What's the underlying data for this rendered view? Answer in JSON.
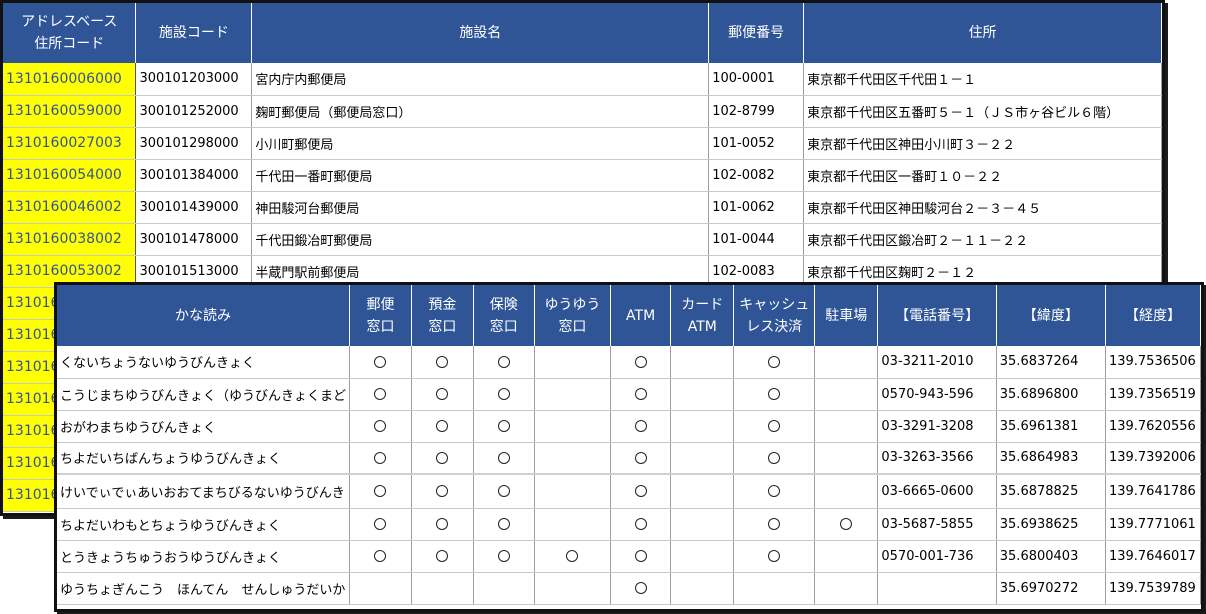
{
  "table1": {
    "headers": {
      "address_code": [
        "アドレスベース",
        "住所コード"
      ],
      "facility_code": "施設コード",
      "facility_name": "施設名",
      "postal_code": "郵便番号",
      "address": "住所"
    },
    "rows": [
      {
        "address_code": "1310160006000",
        "facility_code": "300101203000",
        "facility_name": "宮内庁内郵便局",
        "postal_code": "100-0001",
        "address": "東京都千代田区千代田１－１"
      },
      {
        "address_code": "1310160059000",
        "facility_code": "300101252000",
        "facility_name": "麹町郵便局（郵便局窓口）",
        "postal_code": "102-8799",
        "address": "東京都千代田区五番町５－１（ＪＳ市ヶ谷ビル６階）"
      },
      {
        "address_code": "1310160027003",
        "facility_code": "300101298000",
        "facility_name": "小川町郵便局",
        "postal_code": "101-0052",
        "address": "東京都千代田区神田小川町３－２２"
      },
      {
        "address_code": "1310160054000",
        "facility_code": "300101384000",
        "facility_name": "千代田一番町郵便局",
        "postal_code": "102-0082",
        "address": "東京都千代田区一番町１０－２２"
      },
      {
        "address_code": "1310160046002",
        "facility_code": "300101439000",
        "facility_name": "神田駿河台郵便局",
        "postal_code": "101-0062",
        "address": "東京都千代田区神田駿河台２－３－４５"
      },
      {
        "address_code": "1310160038002",
        "facility_code": "300101478000",
        "facility_name": "千代田鍛冶町郵便局",
        "postal_code": "101-0044",
        "address": "東京都千代田区鍛冶町２－１１－２２"
      },
      {
        "address_code": "1310160053002",
        "facility_code": "300101513000",
        "facility_name": "半蔵門駅前郵便局",
        "postal_code": "102-0083",
        "address": "東京都千代田区麹町２－１２"
      },
      {
        "address_code": "131016",
        "facility_code": "",
        "facility_name": "",
        "postal_code": "",
        "address": ""
      },
      {
        "address_code": "131016",
        "facility_code": "",
        "facility_name": "",
        "postal_code": "",
        "address": ""
      },
      {
        "address_code": "131016",
        "facility_code": "",
        "facility_name": "",
        "postal_code": "",
        "address": ""
      },
      {
        "address_code": "131016",
        "facility_code": "",
        "facility_name": "",
        "postal_code": "",
        "address": ""
      },
      {
        "address_code": "131016",
        "facility_code": "",
        "facility_name": "",
        "postal_code": "",
        "address": ""
      },
      {
        "address_code": "131016",
        "facility_code": "",
        "facility_name": "",
        "postal_code": "",
        "address": ""
      },
      {
        "address_code": "131016",
        "facility_code": "",
        "facility_name": "",
        "postal_code": "",
        "address": ""
      }
    ]
  },
  "table2": {
    "headers": {
      "kana": "かな読み",
      "postal_window": [
        "郵便",
        "窓口"
      ],
      "savings_window": [
        "預金",
        "窓口"
      ],
      "insurance_window": [
        "保険",
        "窓口"
      ],
      "yuyu_window": [
        "ゆうゆう",
        "窓口"
      ],
      "atm": "ATM",
      "card_atm": [
        "カード",
        "ATM"
      ],
      "cashless": [
        "キャッシュ",
        "レス決済"
      ],
      "parking": "駐車場",
      "phone": "【電話番号】",
      "latitude": "【緯度】",
      "longitude": "【経度】"
    },
    "mark_symbol": "circle",
    "rows": [
      {
        "kana": "くないちょうないゆうびんきょく",
        "postal_window": true,
        "savings_window": true,
        "insurance_window": true,
        "yuyu_window": false,
        "atm": true,
        "card_atm": false,
        "cashless": true,
        "parking": false,
        "phone": "03-3211-2010",
        "latitude": "35.6837264",
        "longitude": "139.7536506"
      },
      {
        "kana": "こうじまちゆうびんきょく（ゆうびんきょくまど",
        "postal_window": true,
        "savings_window": true,
        "insurance_window": true,
        "yuyu_window": false,
        "atm": true,
        "card_atm": false,
        "cashless": true,
        "parking": false,
        "phone": "0570-943-596",
        "latitude": "35.6896800",
        "longitude": "139.7356519"
      },
      {
        "kana": "おがわまちゆうびんきょく",
        "postal_window": true,
        "savings_window": true,
        "insurance_window": true,
        "yuyu_window": false,
        "atm": true,
        "card_atm": false,
        "cashless": true,
        "parking": false,
        "phone": "03-3291-3208",
        "latitude": "35.6961381",
        "longitude": "139.7620556"
      },
      {
        "kana": "ちよだいちばんちょうゆうびんきょく",
        "postal_window": true,
        "savings_window": true,
        "insurance_window": true,
        "yuyu_window": false,
        "atm": true,
        "card_atm": false,
        "cashless": true,
        "parking": false,
        "phone": "03-3263-3566",
        "latitude": "35.6864983",
        "longitude": "139.7392006"
      },
      {
        "kana": "けいでぃでぃあいおおてまちびるないゆうびんき",
        "postal_window": true,
        "savings_window": true,
        "insurance_window": true,
        "yuyu_window": false,
        "atm": true,
        "card_atm": false,
        "cashless": true,
        "parking": false,
        "phone": "03-6665-0600",
        "latitude": "35.6878825",
        "longitude": "139.7641786"
      },
      {
        "kana": "ちよだいわもとちょうゆうびんきょく",
        "postal_window": true,
        "savings_window": true,
        "insurance_window": true,
        "yuyu_window": false,
        "atm": true,
        "card_atm": false,
        "cashless": true,
        "parking": true,
        "phone": "03-5687-5855",
        "latitude": "35.6938625",
        "longitude": "139.7771061"
      },
      {
        "kana": "とうきょうちゅうおうゆうびんきょく",
        "postal_window": true,
        "savings_window": true,
        "insurance_window": true,
        "yuyu_window": true,
        "atm": true,
        "card_atm": false,
        "cashless": true,
        "parking": false,
        "phone": "0570-001-736",
        "latitude": "35.6800403",
        "longitude": "139.7646017"
      },
      {
        "kana": "ゆうちょぎんこう　ほんてん　せんしゅうだいか",
        "postal_window": false,
        "savings_window": false,
        "insurance_window": false,
        "yuyu_window": false,
        "atm": true,
        "card_atm": false,
        "cashless": false,
        "parking": false,
        "phone": "",
        "latitude": "35.6970272",
        "longitude": "139.7539789"
      }
    ]
  }
}
